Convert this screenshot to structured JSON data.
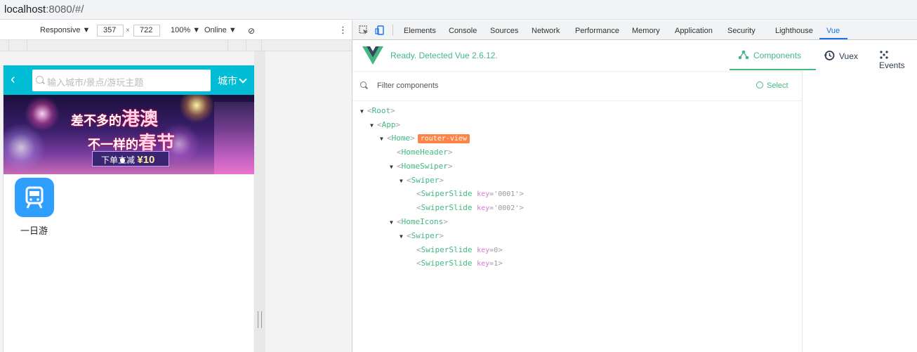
{
  "address_bar": {
    "host": "localhost",
    "rest": ":8080/#/"
  },
  "emulation": {
    "device": "Responsive",
    "width": "357",
    "height": "722",
    "zoom": "100%",
    "network": "Online"
  },
  "mobile": {
    "search_placeholder": "输入城市/景点/游玩主题",
    "city_label": "城市",
    "banner": {
      "line1_small": "差不多的",
      "line1_big": "港澳",
      "line2_small": "不一样的",
      "line2_big": "春节",
      "promo_text": "下单立减",
      "promo_amount": "¥10"
    },
    "icons": [
      {
        "label": "一日游",
        "icon": "tram-icon"
      }
    ]
  },
  "devtools": {
    "tabs": [
      "Elements",
      "Console",
      "Sources",
      "Network",
      "Performance",
      "Memory",
      "Application",
      "Security",
      "Lighthouse",
      "Vue"
    ],
    "active_tab": "Vue"
  },
  "vue": {
    "status": "Ready. Detected Vue 2.6.12.",
    "tabs": [
      "Components",
      "Vuex",
      "Events"
    ],
    "active_tab": "Components",
    "filter_placeholder": "Filter components",
    "select_label": "Select",
    "router_badge": "router-view",
    "tree": [
      {
        "name": "Root",
        "depth": 0,
        "expanded": true
      },
      {
        "name": "App",
        "depth": 1,
        "expanded": true
      },
      {
        "name": "Home",
        "depth": 2,
        "expanded": true,
        "badge": "router-view"
      },
      {
        "name": "HomeHeader",
        "depth": 3,
        "expanded": null
      },
      {
        "name": "HomeSwiper",
        "depth": 3,
        "expanded": true
      },
      {
        "name": "Swiper",
        "depth": 4,
        "expanded": true
      },
      {
        "name": "SwiperSlide",
        "depth": 5,
        "key_label": "key",
        "key_value": "='0001'"
      },
      {
        "name": "SwiperSlide",
        "depth": 5,
        "key_label": "key",
        "key_value": "='0002'"
      },
      {
        "name": "HomeIcons",
        "depth": 3,
        "expanded": true
      },
      {
        "name": "Swiper",
        "depth": 4,
        "expanded": true
      },
      {
        "name": "SwiperSlide",
        "depth": 5,
        "key_label": "key",
        "key_value": "=0"
      },
      {
        "name": "SwiperSlide",
        "depth": 5,
        "key_label": "key",
        "key_value": "=1"
      }
    ]
  },
  "colors": {
    "vue_green": "#42b883",
    "mobile_header": "#00bcd4",
    "badge_orange": "#ff8344",
    "devtools_blue": "#1a73e8"
  }
}
